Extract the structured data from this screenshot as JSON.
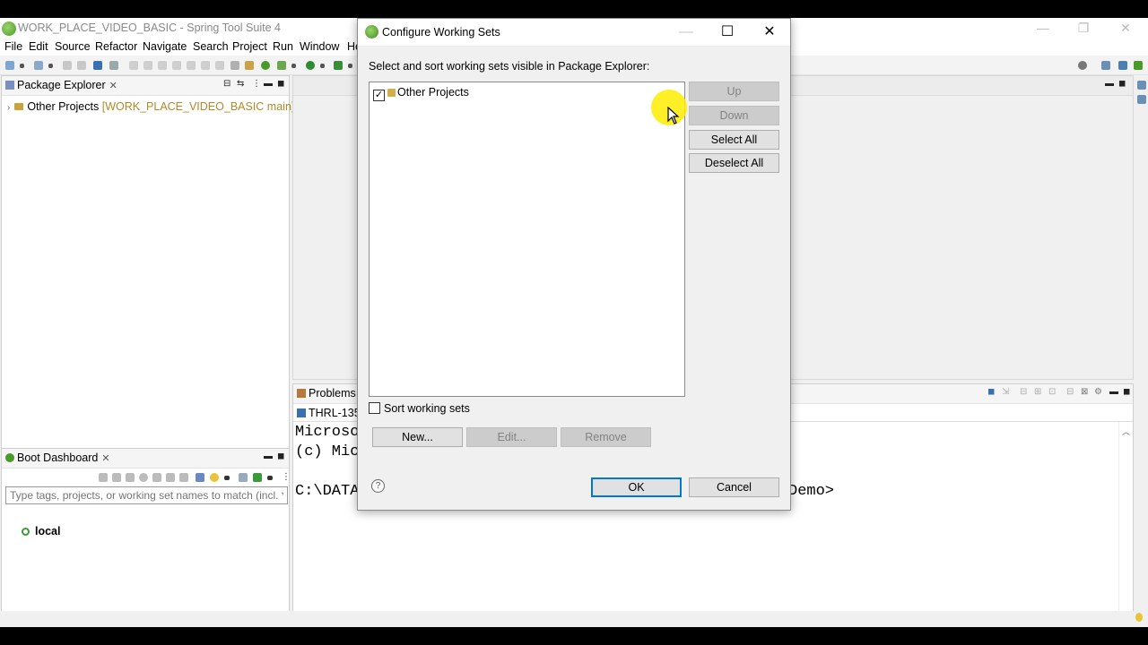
{
  "window": {
    "title": "WORK_PLACE_VIDEO_BASIC - Spring Tool Suite 4"
  },
  "menu": [
    "File",
    "Edit",
    "Source",
    "Refactor",
    "Navigate",
    "Search",
    "Project",
    "Run",
    "Window",
    "He"
  ],
  "package_explorer": {
    "tab_label": "Package Explorer",
    "items": [
      {
        "label": "Other Projects",
        "decoration": "[WORK_PLACE_VIDEO_BASIC main]"
      }
    ]
  },
  "boot_dashboard": {
    "tab_label": "Boot Dashboard",
    "filter_placeholder": "Type tags, projects, or working set names to match (incl. *",
    "items": [
      "local"
    ]
  },
  "bottom_panel": {
    "tab_label": "Problems",
    "console_tab": "THRL-135(",
    "console_lines": [
      "Microso",
      "(c) Mic",
      "",
      "C:\\DATA"
    ],
    "console_suffix": "Demo>"
  },
  "dialog": {
    "title": "Configure Working Sets",
    "instruction": "Select and sort working sets visible in Package Explorer:",
    "working_sets": [
      {
        "label": "Other Projects",
        "checked": true
      }
    ],
    "side_buttons": {
      "up": "Up",
      "down": "Down",
      "select_all": "Select All",
      "deselect_all": "Deselect All"
    },
    "sort_label": "Sort working sets",
    "sort_checked": false,
    "action_buttons": {
      "new": "New...",
      "edit": "Edit...",
      "remove": "Remove"
    },
    "ok": "OK",
    "cancel": "Cancel",
    "help_glyph": "?"
  },
  "colors": {
    "accent": "#0078d7",
    "cursor_highlight": "#ffec00",
    "spring_green": "#6db33f"
  }
}
